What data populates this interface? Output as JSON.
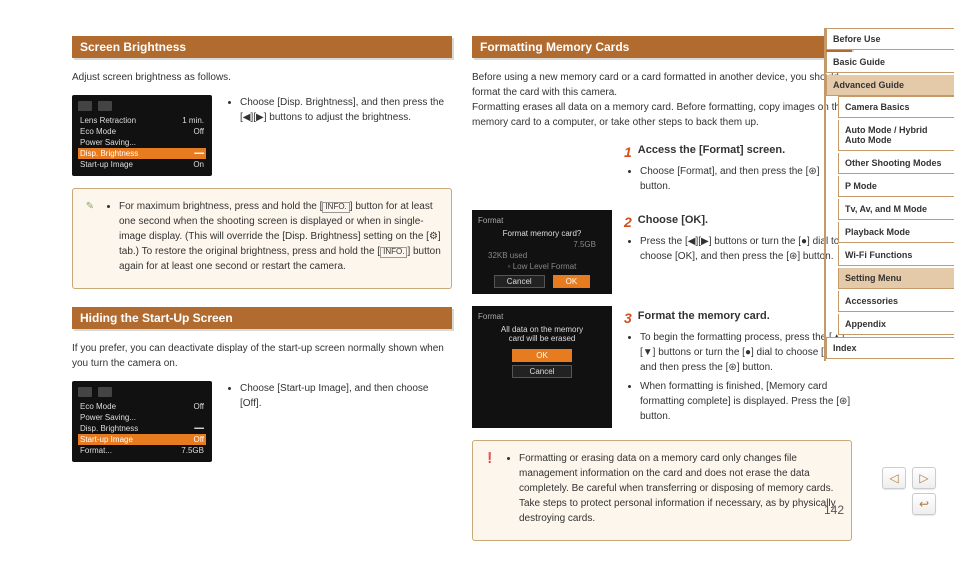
{
  "left": {
    "sec1": {
      "title": "Screen Brightness",
      "intro": "Adjust screen brightness as follows.",
      "cam": {
        "r1a": "Lens Retraction",
        "r1b": "1 min.",
        "r2a": "Eco Mode",
        "r2b": "Off",
        "r3a": "Power Saving...",
        "r4a": "Disp. Brightness",
        "r5a": "Start-up Image",
        "r5b": "On"
      },
      "bullet": "Choose [Disp. Brightness], and then press the [◀][▶] buttons to adjust the brightness."
    },
    "tip1": {
      "t1": "For maximum brightness, press and hold the [",
      "info1": "INFO.",
      "t2": "] button for at least one second when the shooting screen is displayed or when in single-image display. (This will override the [Disp. Brightness] setting on the [⚙] tab.) To restore the original brightness, press and hold the [",
      "info2": "INFO.",
      "t3": "] button again for at least one second or restart the camera."
    },
    "sec2": {
      "title": "Hiding the Start-Up Screen",
      "intro": "If you prefer, you can deactivate display of the start-up screen normally shown when you turn the camera on.",
      "cam": {
        "r1a": "Eco Mode",
        "r1b": "Off",
        "r2a": "Power Saving...",
        "r3a": "Disp. Brightness",
        "r4a": "Start-up Image",
        "r4b": "Off",
        "r5a": "Format...",
        "r5b": "7.5GB"
      },
      "bullet": "Choose [Start-up Image], and then choose [Off]."
    }
  },
  "right": {
    "sec3": {
      "title": "Formatting Memory Cards",
      "intro": "Before using a new memory card or a card formatted in another device, you should format the card with this camera.\nFormatting erases all data on a memory card. Before formatting, copy images on the memory card to a computer, or take other steps to back them up.",
      "step1num": "1",
      "step1": "Access the [Format] screen.",
      "step1b": "Choose [Format], and then press the [⊛] button.",
      "step2num": "2",
      "step2": "Choose [OK].",
      "step2b": "Press the [◀][▶] buttons or turn the [●] dial to choose [OK], and then press the [⊛] button.",
      "step3num": "3",
      "step3": "Format the memory card.",
      "step3b1": "To begin the formatting process, press the [▲][▼] buttons or turn the [●] dial to choose [OK], and then press the [⊛] button.",
      "step3b2": "When formatting is finished, [Memory card formatting complete] is displayed. Press the [⊛] button.",
      "dlg1": {
        "title": "Format",
        "msg": "Format memory card?",
        "used": "32KB used",
        "total": "7.5GB",
        "low": "Low Level Format",
        "cancel": "Cancel",
        "ok": "OK"
      },
      "dlg2": {
        "title": "Format",
        "msg1": "All data on the memory",
        "msg2": "card will be erased",
        "ok": "OK",
        "cancel": "Cancel"
      }
    },
    "warn": "Formatting or erasing data on a memory card only changes file management information on the card and does not erase the data completely. Be careful when transferring or disposing of memory cards. Take steps to protect personal information if necessary, as by physically destroying cards."
  },
  "nav": {
    "i0": "Before Use",
    "i1": "Basic Guide",
    "i2": "Advanced Guide",
    "s0": "Camera Basics",
    "s1": "Auto Mode / Hybrid Auto Mode",
    "s2": "Other Shooting Modes",
    "s3": "P Mode",
    "s4": "Tv, Av, and M Mode",
    "s5": "Playback Mode",
    "s6": "Wi-Fi Functions",
    "s7": "Setting Menu",
    "s8": "Accessories",
    "s9": "Appendix",
    "i3": "Index"
  },
  "pagenum": "142"
}
